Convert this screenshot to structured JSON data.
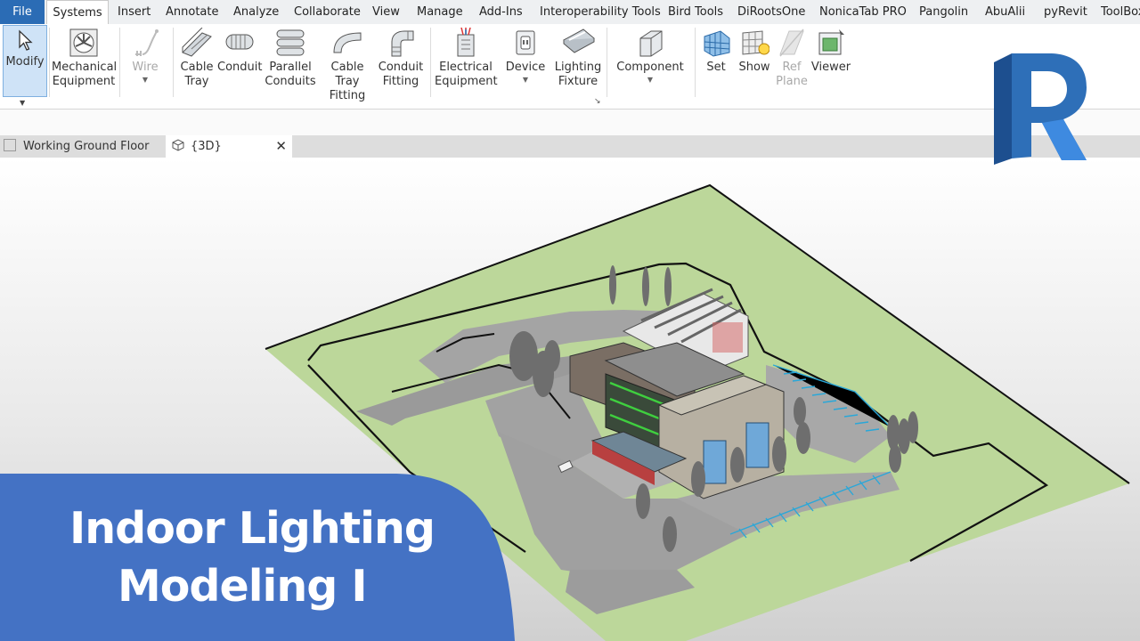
{
  "menubar": {
    "file": "File",
    "tabs": [
      "Systems",
      "Insert",
      "Annotate",
      "Analyze",
      "Collaborate",
      "View",
      "Manage",
      "Add-Ins",
      "Interoperability Tools",
      "Bird Tools",
      "DiRootsOne",
      "NonicaTab PRO",
      "Pangolin",
      "AbuAlii",
      "pyRevit",
      "ToolBox"
    ],
    "active_tab": "Systems"
  },
  "ribbon": {
    "modify": "Modify",
    "mech_line1": "Mechanical",
    "mech_line2": "Equipment",
    "wire": "Wire",
    "cable_line1": "Cable",
    "cable_line2": "Tray",
    "conduit": "Conduit",
    "parallel_line1": "Parallel",
    "parallel_line2": "Conduits",
    "ctf_line1": "Cable Tray",
    "ctf_line2": "Fitting",
    "cf_line1": "Conduit",
    "cf_line2": "Fitting",
    "elec_line1": "Electrical",
    "elec_line2": "Equipment",
    "device": "Device",
    "lf_line1": "Lighting",
    "lf_line2": "Fixture",
    "component": "Component",
    "set": "Set",
    "show": "Show",
    "ref_line1": "Ref",
    "ref_line2": "Plane",
    "viewer": "Viewer"
  },
  "view_tabs": {
    "tab1": "Working Ground Floor",
    "tab2": "{3D}"
  },
  "overlay": {
    "title_line1": "Indoor Lighting",
    "title_line2": "Modeling I",
    "banner_color": "#4472c4"
  },
  "logo": {
    "letter": "R",
    "color": "#2e6fb8"
  }
}
